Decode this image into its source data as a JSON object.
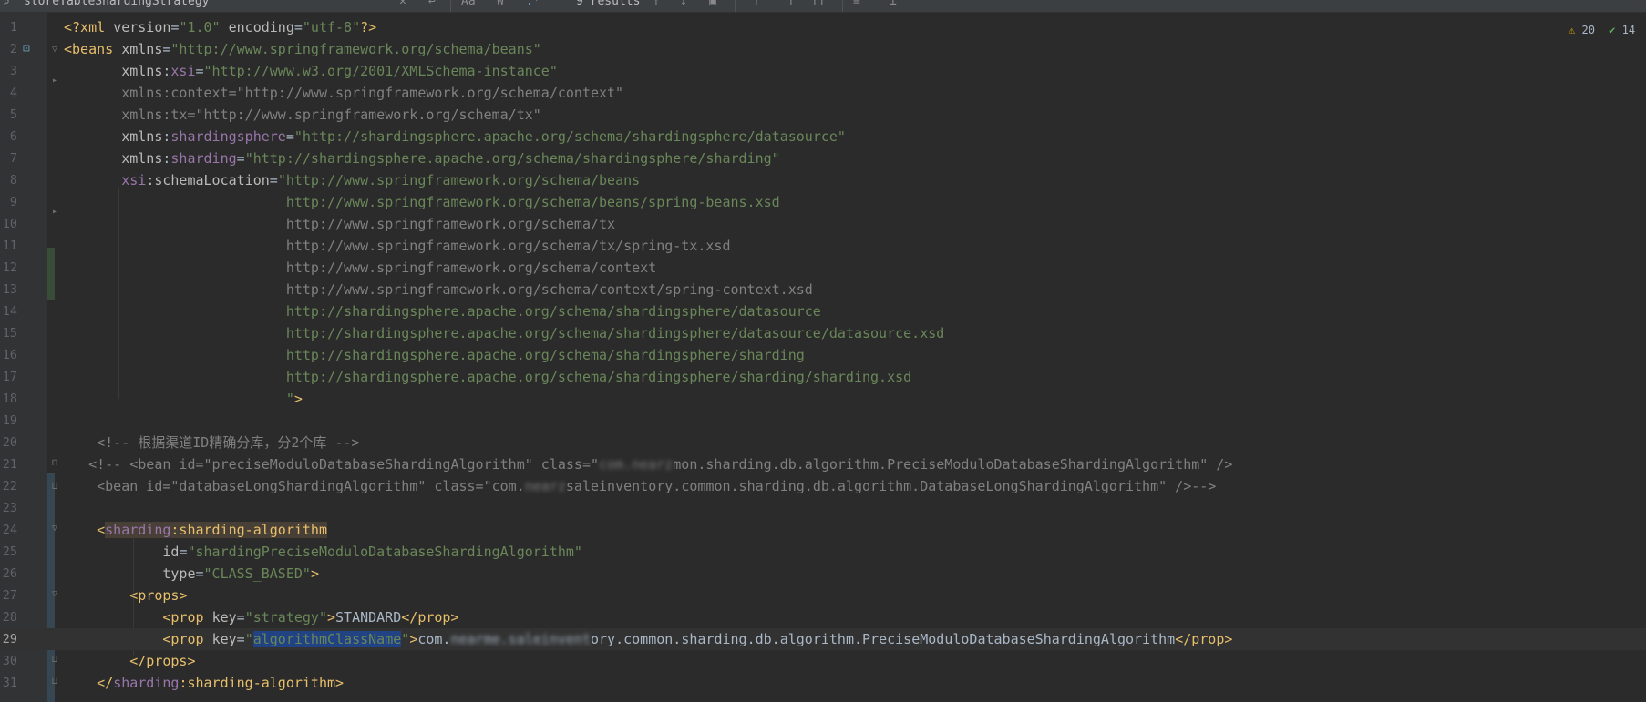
{
  "find_bar": {
    "query": "storeTableShardingStrategy",
    "results": "9 results",
    "icons": [
      "search-icon",
      "clear-icon",
      "history-icon",
      "match-case-icon",
      "words-icon",
      "regex-icon",
      "prev-occurrence-icon",
      "next-occurrence-icon",
      "select-all-icon",
      "filter-icon",
      "options-icon",
      "multiline-icon",
      "close-icon"
    ]
  },
  "inspections": {
    "warnings": "20",
    "ok_checks": "14"
  },
  "editor": {
    "current_line": 29,
    "lines": [
      {
        "n": "1",
        "segs": [
          {
            "t": "<?xml ",
            "c": "pi"
          },
          {
            "t": "version",
            "c": "attr"
          },
          {
            "t": "=",
            "c": "plain"
          },
          {
            "t": "\"1.0\"",
            "c": "val"
          },
          {
            "t": " encoding",
            "c": "attr"
          },
          {
            "t": "=",
            "c": "plain"
          },
          {
            "t": "\"utf-8\"",
            "c": "val"
          },
          {
            "t": "?>",
            "c": "pi"
          }
        ]
      },
      {
        "n": "2",
        "segs": [
          {
            "t": "<beans ",
            "c": "tag"
          },
          {
            "t": "xmlns",
            "c": "attr"
          },
          {
            "t": "=",
            "c": "plain"
          },
          {
            "t": "\"http://www.springframework.org/schema/beans\"",
            "c": "val"
          }
        ]
      },
      {
        "n": "3",
        "segs": [
          {
            "t": "       xmlns",
            "c": "attr"
          },
          {
            "t": ":",
            "c": "plain"
          },
          {
            "t": "xsi",
            "c": "ns"
          },
          {
            "t": "=",
            "c": "plain"
          },
          {
            "t": "\"http://www.w3.org/2001/XMLSchema-instance\"",
            "c": "val"
          }
        ]
      },
      {
        "n": "4",
        "segs": [
          {
            "t": "       xmlns:context=\"http://www.springframework.org/schema/context\"",
            "c": "cmt"
          }
        ]
      },
      {
        "n": "5",
        "segs": [
          {
            "t": "       xmlns:tx=\"http://www.springframework.org/schema/tx\"",
            "c": "cmt"
          }
        ]
      },
      {
        "n": "6",
        "segs": [
          {
            "t": "       xmlns",
            "c": "attr"
          },
          {
            "t": ":",
            "c": "plain"
          },
          {
            "t": "shardingsphere",
            "c": "ns"
          },
          {
            "t": "=",
            "c": "plain"
          },
          {
            "t": "\"http://shardingsphere.apache.org/schema/shardingsphere/datasource\"",
            "c": "val"
          }
        ]
      },
      {
        "n": "7",
        "segs": [
          {
            "t": "       xmlns",
            "c": "attr"
          },
          {
            "t": ":",
            "c": "plain"
          },
          {
            "t": "sharding",
            "c": "ns"
          },
          {
            "t": "=",
            "c": "plain"
          },
          {
            "t": "\"http://shardingsphere.apache.org/schema/shardingsphere/sharding\"",
            "c": "val"
          }
        ]
      },
      {
        "n": "8",
        "segs": [
          {
            "t": "       ",
            "c": "plain"
          },
          {
            "t": "xsi",
            "c": "ns"
          },
          {
            "t": ":schemaLocation",
            "c": "attr"
          },
          {
            "t": "=",
            "c": "plain"
          },
          {
            "t": "\"http://www.springframework.org/schema/beans",
            "c": "val"
          }
        ]
      },
      {
        "n": "9",
        "segs": [
          {
            "t": "                           http://www.springframework.org/schema/beans/spring-beans.xsd",
            "c": "val"
          }
        ]
      },
      {
        "n": "10",
        "segs": [
          {
            "t": "                           http://www.springframework.org/schema/tx",
            "c": "cmt"
          }
        ]
      },
      {
        "n": "11",
        "segs": [
          {
            "t": "                           http://www.springframework.org/schema/tx/spring-tx.xsd",
            "c": "cmt"
          }
        ]
      },
      {
        "n": "12",
        "segs": [
          {
            "t": "                           http://www.springframework.org/schema/context",
            "c": "cmt"
          }
        ]
      },
      {
        "n": "13",
        "segs": [
          {
            "t": "                           http://www.springframework.org/schema/context/spring-context.xsd",
            "c": "cmt"
          }
        ]
      },
      {
        "n": "14",
        "segs": [
          {
            "t": "                           http://shardingsphere.apache.org/schema/shardingsphere/datasource",
            "c": "val"
          }
        ]
      },
      {
        "n": "15",
        "segs": [
          {
            "t": "                           http://shardingsphere.apache.org/schema/shardingsphere/datasource/datasource.xsd",
            "c": "val"
          }
        ]
      },
      {
        "n": "16",
        "segs": [
          {
            "t": "                           http://shardingsphere.apache.org/schema/shardingsphere/sharding",
            "c": "val"
          }
        ]
      },
      {
        "n": "17",
        "segs": [
          {
            "t": "                           http://shardingsphere.apache.org/schema/shardingsphere/sharding/sharding.xsd",
            "c": "val"
          }
        ]
      },
      {
        "n": "18",
        "segs": [
          {
            "t": "                           \"",
            "c": "val"
          },
          {
            "t": ">",
            "c": "tag"
          }
        ]
      },
      {
        "n": "19",
        "segs": []
      },
      {
        "n": "20",
        "segs": [
          {
            "t": "    <!-- 根据渠道ID精确分库，分2个库 -->",
            "c": "cmt"
          }
        ]
      },
      {
        "n": "21",
        "segs": [
          {
            "t": "   <!-- <bean id=\"preciseModuloDatabaseShardingAlgorithm\" class=\"",
            "c": "cmt"
          },
          {
            "t": "com.nearz",
            "c": "cmt-blur"
          },
          {
            "t": "mon.sharding.db.algorithm.PreciseModuloDatabaseShardingAlgorithm\" />",
            "c": "cmt"
          }
        ]
      },
      {
        "n": "22",
        "segs": [
          {
            "t": "    <bean id=\"databaseLongShardingAlgorithm\" class=\"com.",
            "c": "cmt"
          },
          {
            "t": "nearz",
            "c": "cmt-blur"
          },
          {
            "t": "saleinventory.common.sharding.db.algorithm.DatabaseLongShardingAlgorithm\" />-->",
            "c": "cmt"
          }
        ]
      },
      {
        "n": "23",
        "segs": []
      },
      {
        "n": "24",
        "segs": [
          {
            "t": "    ",
            "c": "plain"
          },
          {
            "t": "<",
            "c": "tag"
          },
          {
            "t": "sharding",
            "c": "ns-hl"
          },
          {
            "t": ":sharding-algorithm",
            "c": "tag-hl"
          }
        ]
      },
      {
        "n": "25",
        "segs": [
          {
            "t": "            id",
            "c": "attr"
          },
          {
            "t": "=",
            "c": "plain"
          },
          {
            "t": "\"shardingPreciseModuloDatabaseShardingAlgorithm\"",
            "c": "val"
          }
        ]
      },
      {
        "n": "26",
        "segs": [
          {
            "t": "            type",
            "c": "attr"
          },
          {
            "t": "=",
            "c": "plain"
          },
          {
            "t": "\"CLASS_BASED\"",
            "c": "val"
          },
          {
            "t": ">",
            "c": "tag"
          }
        ]
      },
      {
        "n": "27",
        "segs": [
          {
            "t": "        <props>",
            "c": "tag"
          }
        ]
      },
      {
        "n": "28",
        "segs": [
          {
            "t": "            <prop ",
            "c": "tag"
          },
          {
            "t": "key",
            "c": "attr"
          },
          {
            "t": "=",
            "c": "plain"
          },
          {
            "t": "\"strategy\"",
            "c": "val"
          },
          {
            "t": ">",
            "c": "tag"
          },
          {
            "t": "STANDARD",
            "c": "plain"
          },
          {
            "t": "</prop>",
            "c": "tag"
          }
        ]
      },
      {
        "n": "29",
        "segs": [
          {
            "t": "            <prop ",
            "c": "tag"
          },
          {
            "t": "key",
            "c": "attr"
          },
          {
            "t": "=",
            "c": "plain"
          },
          {
            "t": "\"",
            "c": "val"
          },
          {
            "t": "algorithmClassName",
            "c": "val-sel"
          },
          {
            "t": "\"",
            "c": "val"
          },
          {
            "t": ">",
            "c": "tag"
          },
          {
            "t": "com.",
            "c": "plain"
          },
          {
            "t": "nearme.saleinvent",
            "c": "plain-blur"
          },
          {
            "t": "ory.common.sharding.db.algorithm.PreciseModuloDatabaseShardingAlgorithm",
            "c": "plain"
          },
          {
            "t": "</prop>",
            "c": "tag"
          }
        ]
      },
      {
        "n": "30",
        "segs": [
          {
            "t": "        </props>",
            "c": "tag"
          }
        ]
      },
      {
        "n": "31",
        "segs": [
          {
            "t": "    </",
            "c": "tag"
          },
          {
            "t": "sharding",
            "c": "ns"
          },
          {
            "t": ":sharding-algorithm>",
            "c": "tag"
          }
        ]
      }
    ]
  }
}
